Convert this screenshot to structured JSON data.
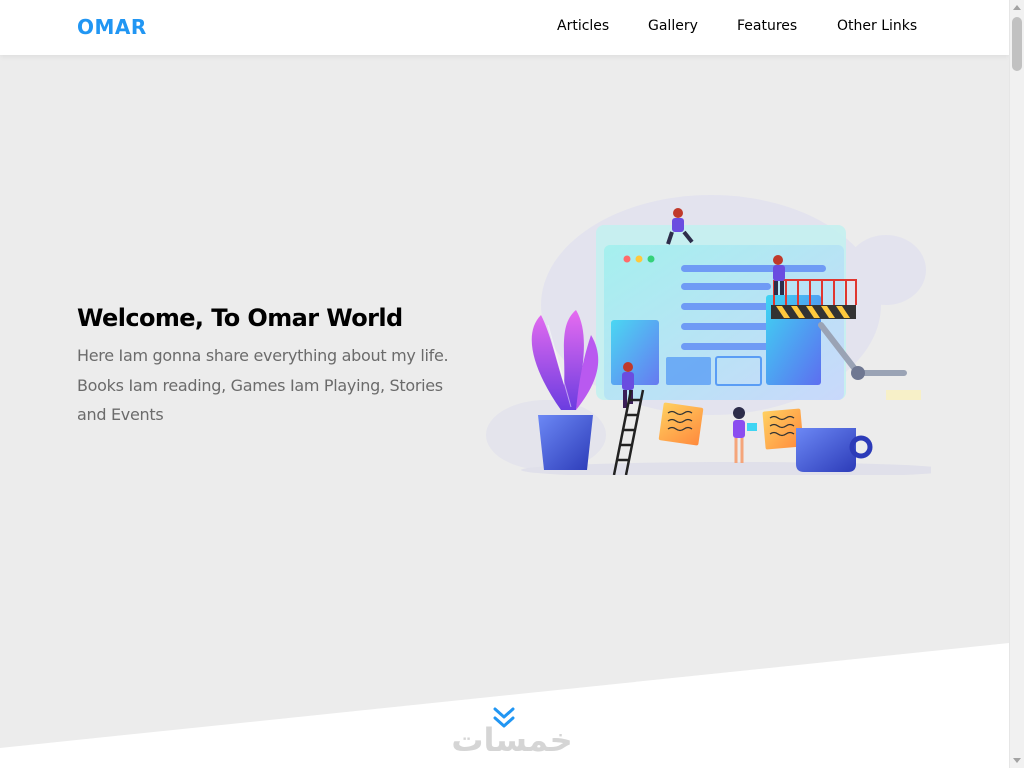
{
  "header": {
    "logo": "OMAR",
    "nav": [
      {
        "label": "Articles"
      },
      {
        "label": "Gallery"
      },
      {
        "label": "Features"
      },
      {
        "label": "Other Links"
      }
    ]
  },
  "hero": {
    "title": "Welcome, To Omar World",
    "text": "Here Iam gonna share everything about my life. Books Iam reading, Games Iam Playing, Stories and Events"
  },
  "icons": {
    "scroll_down": "double-chevron-down-icon",
    "illustration": "team-building-website-illustration"
  },
  "watermark": "خمسات",
  "colors": {
    "accent": "#2196f3",
    "background": "#ececec",
    "header": "#ffffff",
    "text_muted": "#6b6b6b"
  }
}
